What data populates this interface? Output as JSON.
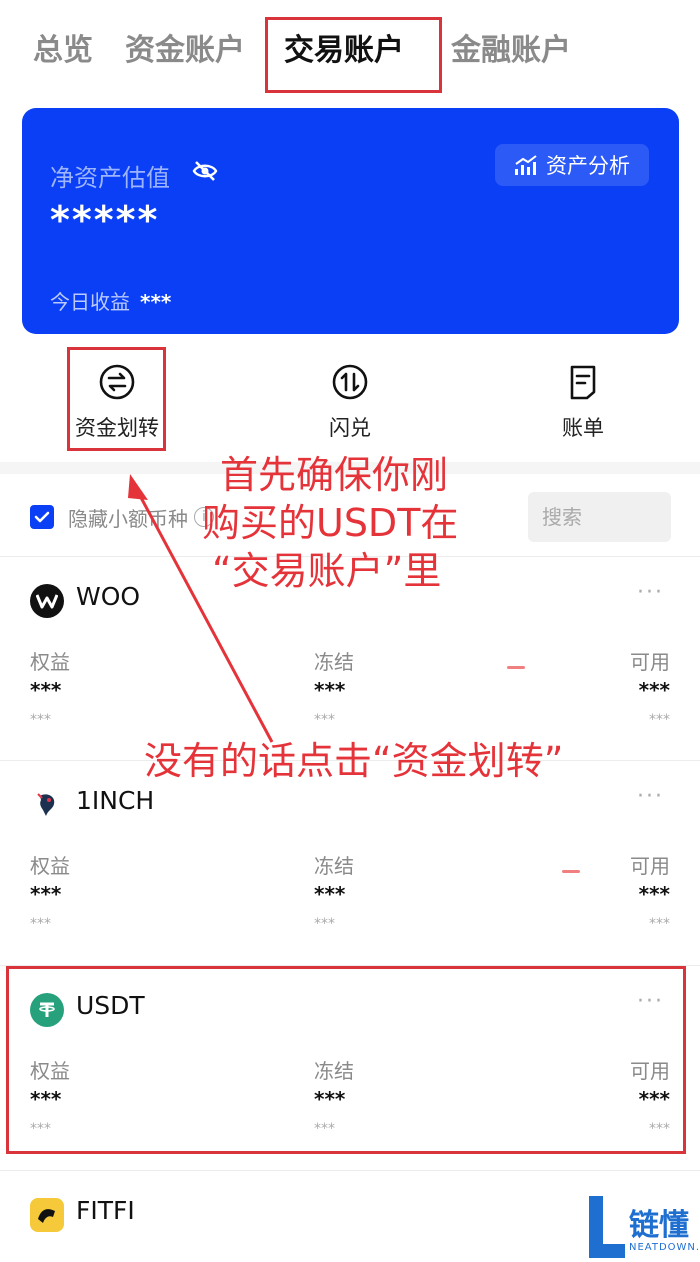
{
  "tabs": [
    {
      "label": "总览",
      "active": false
    },
    {
      "label": "资金账户",
      "active": false
    },
    {
      "label": "交易账户",
      "active": true
    },
    {
      "label": "金融账户",
      "active": false
    }
  ],
  "card": {
    "net_asset_label": "净资产估值",
    "net_asset_value": "*****",
    "analysis_label": "资产分析",
    "today_label": "今日收益",
    "today_value": "***",
    "bg_color": "#0a3ff5"
  },
  "actions": [
    {
      "label": "资金划转",
      "icon": "transfer-icon"
    },
    {
      "label": "闪兑",
      "icon": "swap-icon"
    },
    {
      "label": "账单",
      "icon": "bill-icon"
    }
  ],
  "filter": {
    "hide_small_label": "隐藏小额币种",
    "checked": true,
    "search_placeholder": "搜索"
  },
  "columns": {
    "equity": "权益",
    "frozen": "冻结",
    "available": "可用"
  },
  "assets": [
    {
      "name": "WOO",
      "equity": "***",
      "frozen": "***",
      "available": "***",
      "equity_sub": "***",
      "frozen_sub": "***",
      "available_sub": "***",
      "more": "···"
    },
    {
      "name": "1INCH",
      "equity": "***",
      "frozen": "***",
      "available": "***",
      "equity_sub": "***",
      "frozen_sub": "***",
      "available_sub": "***",
      "more": "···"
    },
    {
      "name": "USDT",
      "equity": "***",
      "frozen": "***",
      "available": "***",
      "equity_sub": "***",
      "frozen_sub": "***",
      "available_sub": "***",
      "more": "···"
    },
    {
      "name": "FITFI"
    }
  ],
  "annotations": {
    "line1": "首先确保你刚",
    "line2": "购买的USDT在",
    "line3": "“交易账户”里",
    "line4": "没有的话点击“资金划转”",
    "color": "#e5333a"
  },
  "watermark": {
    "text": "链懂",
    "sub": "NEATDOWN.COM"
  }
}
